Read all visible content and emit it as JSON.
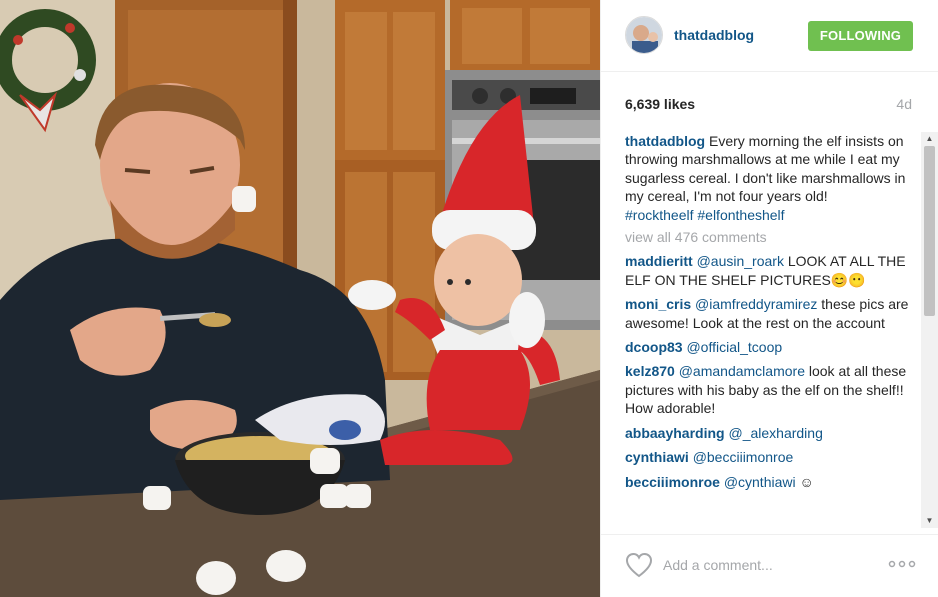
{
  "post": {
    "username": "thatdadblog",
    "follow_label": "FOLLOWING",
    "likes": "6,639 likes",
    "age": "4d"
  },
  "caption": {
    "username": "thatdadblog",
    "text": "Every morning the elf insists on throwing marshmallows at me while I eat my sugarless cereal. I don't like marshmallows in my cereal, I'm not four years old!",
    "hashtags": "#rocktheelf #elfontheshelf"
  },
  "view_all": "view all 476 comments",
  "comments": [
    {
      "user": "maddieritt",
      "mention": "@ausin_roark",
      "text": "LOOK AT ALL THE ELF ON THE SHELF PICTURES😊😶"
    },
    {
      "user": "moni_cris",
      "mention": "@iamfreddyramirez",
      "text": "these pics are awesome! Look at the rest on the account"
    },
    {
      "user": "dcoop83",
      "mention": "@official_tcoop",
      "text": ""
    },
    {
      "user": "kelz870",
      "mention": "@amandamclamore",
      "text": "look at all these pictures with his baby as the elf on the shelf!! How adorable!"
    },
    {
      "user": "abbaayharding",
      "mention": "@_alexharding",
      "text": ""
    },
    {
      "user": "cynthiawi",
      "mention": "@becciiimonroe",
      "text": ""
    },
    {
      "user": "becciiimonroe",
      "mention": "@cynthiawi",
      "text": "☺"
    }
  ],
  "footer": {
    "add_comment_placeholder": "Add a comment..."
  },
  "icons": {
    "heart": "heart-outline-icon",
    "more": "ellipsis-icon",
    "scroll_up": "triangle-up",
    "scroll_down": "triangle-down"
  },
  "colors": {
    "link": "#125688",
    "follow_button": "#70c050",
    "muted": "#a5a7aa"
  }
}
